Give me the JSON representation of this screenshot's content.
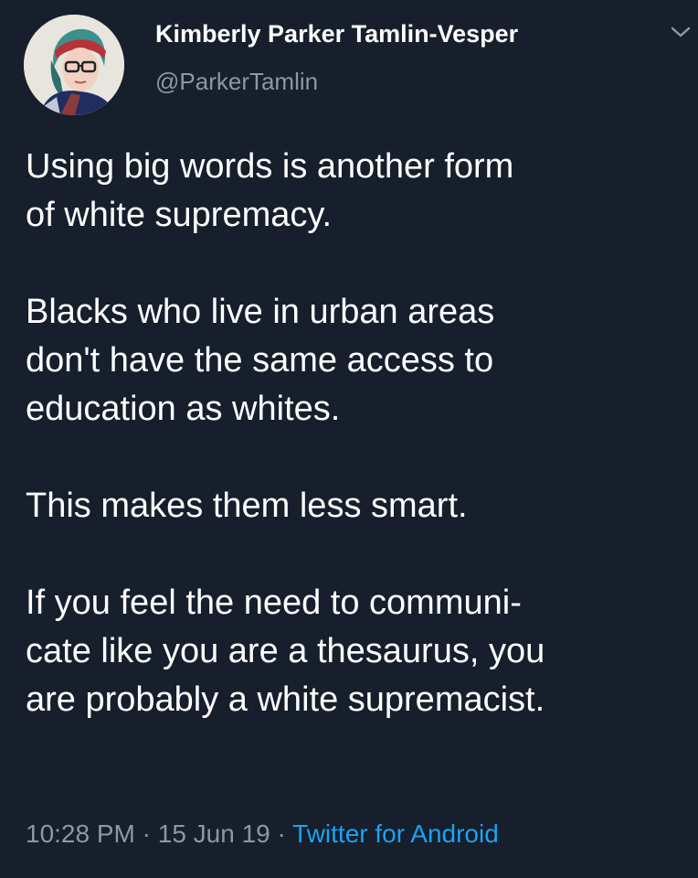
{
  "author": {
    "display_name": "Kimberly Parker Tamlin-Vesper",
    "handle": "@ParkerTamlin",
    "avatar_icon": "profile-photo"
  },
  "menu": {
    "icon": "chevron-down-icon"
  },
  "tweet": {
    "paragraphs": [
      "Using big words is another form\nof white supremacy.",
      "Blacks who live in urban areas\ndon't have the same access to\neducation as whites.",
      "This makes them less smart.",
      "If you feel the need to communi-\ncate like you are a thesaurus, you\nare probably a white supremacist."
    ]
  },
  "meta": {
    "time": "10:28 PM",
    "separator": " · ",
    "date": "15 Jun 19",
    "source": "Twitter for Android"
  },
  "colors": {
    "background": "#161f2b",
    "text": "#ffffff",
    "muted": "#8b98a5",
    "link": "#1da1f2"
  }
}
